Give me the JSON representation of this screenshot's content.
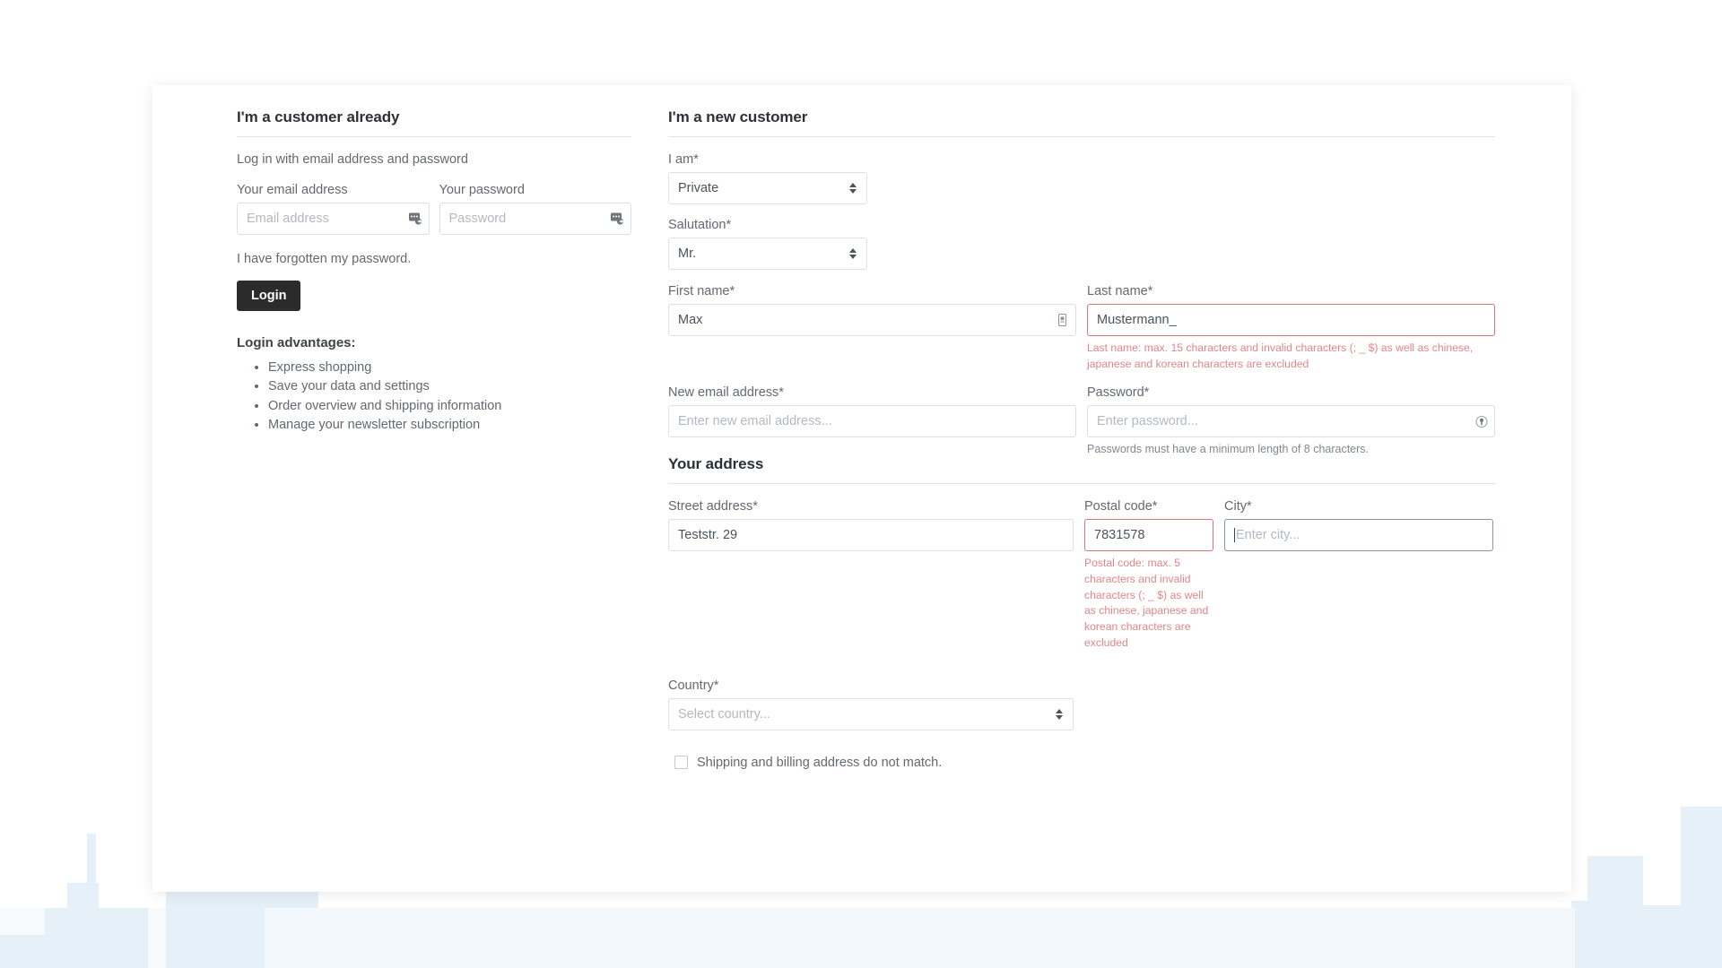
{
  "login": {
    "title": "I'm a customer already",
    "lead": "Log in with email address and password",
    "email_label": "Your email address",
    "email_placeholder": "Email address",
    "email_value": "",
    "password_label": "Your password",
    "password_placeholder": "Password",
    "password_value": "",
    "forgot_text": "I have forgotten my password.",
    "login_button": "Login",
    "advantages_title": "Login advantages:",
    "advantages": [
      "Express shopping",
      "Save your data and settings",
      "Order overview and shipping information",
      "Manage your newsletter subscription"
    ]
  },
  "register": {
    "title": "I'm a new customer",
    "account_type_label": "I am*",
    "account_type_value": "Private",
    "salutation_label": "Salutation*",
    "salutation_value": "Mr.",
    "first_name_label": "First name*",
    "first_name_value": "Max",
    "last_name_label": "Last name*",
    "last_name_value": "Mustermann_",
    "last_name_error": "Last name: max. 15 characters and invalid characters (; _ $) as well as chinese, japanese and korean characters are excluded",
    "email_label": "New email address*",
    "email_placeholder": "Enter new email address...",
    "email_value": "",
    "password_label": "Password*",
    "password_placeholder": "Enter password...",
    "password_value": "",
    "password_hint": "Passwords must have a minimum length of 8 characters."
  },
  "address": {
    "title": "Your address",
    "street_label": "Street address*",
    "street_value": "Teststr. 29",
    "postal_label": "Postal code*",
    "postal_value": "7831578",
    "postal_error": "Postal code: max. 5 characters and invalid characters (; _ $) as well as chinese, japanese and korean characters are excluded",
    "city_label": "City*",
    "city_placeholder": "Enter city...",
    "city_value": "",
    "country_label": "Country*",
    "country_placeholder": "Select country...",
    "country_value": "",
    "shipping_checkbox_label": "Shipping and billing address do not match."
  },
  "colors": {
    "error": "#e0868c",
    "error_border": "#d9737a",
    "button": "#2b2b2b",
    "text": "#4a545b",
    "skyline": "#e6f0f8"
  },
  "icons": {
    "autofill": "autofill-key-icon",
    "password_reveal": "password-reveal-icon",
    "firstname_autofill": "contact-card-icon",
    "select_caret": "chevron-updown-icon"
  }
}
